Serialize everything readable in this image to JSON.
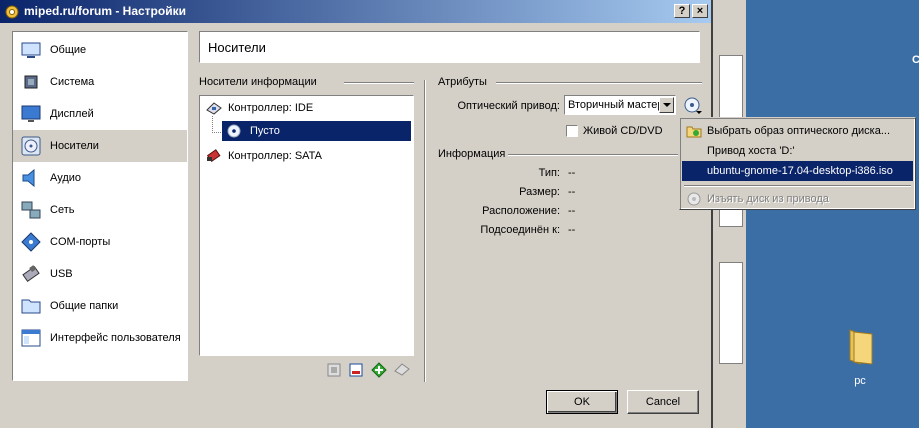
{
  "window": {
    "title": "miped.ru/forum - Настройки",
    "help_label": "?",
    "close_label": "×"
  },
  "categories": [
    {
      "label": "Общие",
      "icon": "general-icon"
    },
    {
      "label": "Система",
      "icon": "system-icon"
    },
    {
      "label": "Дисплей",
      "icon": "display-icon"
    },
    {
      "label": "Носители",
      "icon": "storage-icon",
      "selected": true
    },
    {
      "label": "Аудио",
      "icon": "audio-icon"
    },
    {
      "label": "Сеть",
      "icon": "network-icon"
    },
    {
      "label": "COM-порты",
      "icon": "serial-ports-icon"
    },
    {
      "label": "USB",
      "icon": "usb-icon"
    },
    {
      "label": "Общие папки",
      "icon": "shared-folder-icon"
    },
    {
      "label": "Интерфейс пользователя",
      "icon": "user-interface-icon"
    }
  ],
  "page_title": "Носители",
  "storage": {
    "heading": "Носители информации",
    "tree": [
      {
        "label": "Контроллер: IDE",
        "icon": "ide-controller-icon"
      },
      {
        "label": "Пусто",
        "icon": "cd-disc-icon",
        "selected": true
      },
      {
        "label": "Контроллер: SATA",
        "icon": "sata-controller-icon"
      }
    ]
  },
  "attributes": {
    "heading": "Атрибуты",
    "optical_drive_label": "Оптический привод:",
    "optical_drive_value": "Вторичный мастер",
    "live_cd_label": "Живой CD/DVD",
    "live_cd_checked": false
  },
  "information": {
    "heading": "Информация",
    "rows": [
      {
        "label": "Тип:",
        "value": "--"
      },
      {
        "label": "Размер:",
        "value": "--"
      },
      {
        "label": "Расположение:",
        "value": "--"
      },
      {
        "label": "Подсоединён к:",
        "value": "--"
      }
    ]
  },
  "popup_menu": [
    {
      "label": "Выбрать образ оптического диска...",
      "icon": "choose-disk-icon"
    },
    {
      "label": "Привод хоста 'D:'",
      "icon": ""
    },
    {
      "label": "ubuntu-gnome-17.04-desktop-i386.iso",
      "icon": "",
      "active": true
    },
    {
      "label": "Изъять диск из привода",
      "icon": "eject-disk-icon",
      "disabled": true
    }
  ],
  "buttons": {
    "ok": "OK",
    "cancel": "Cancel"
  },
  "desktop": {
    "icon_label": "pc"
  },
  "colors": {
    "selection": "#0a246a",
    "face": "#d4d0c8",
    "desktop": "#3a6ea5"
  }
}
